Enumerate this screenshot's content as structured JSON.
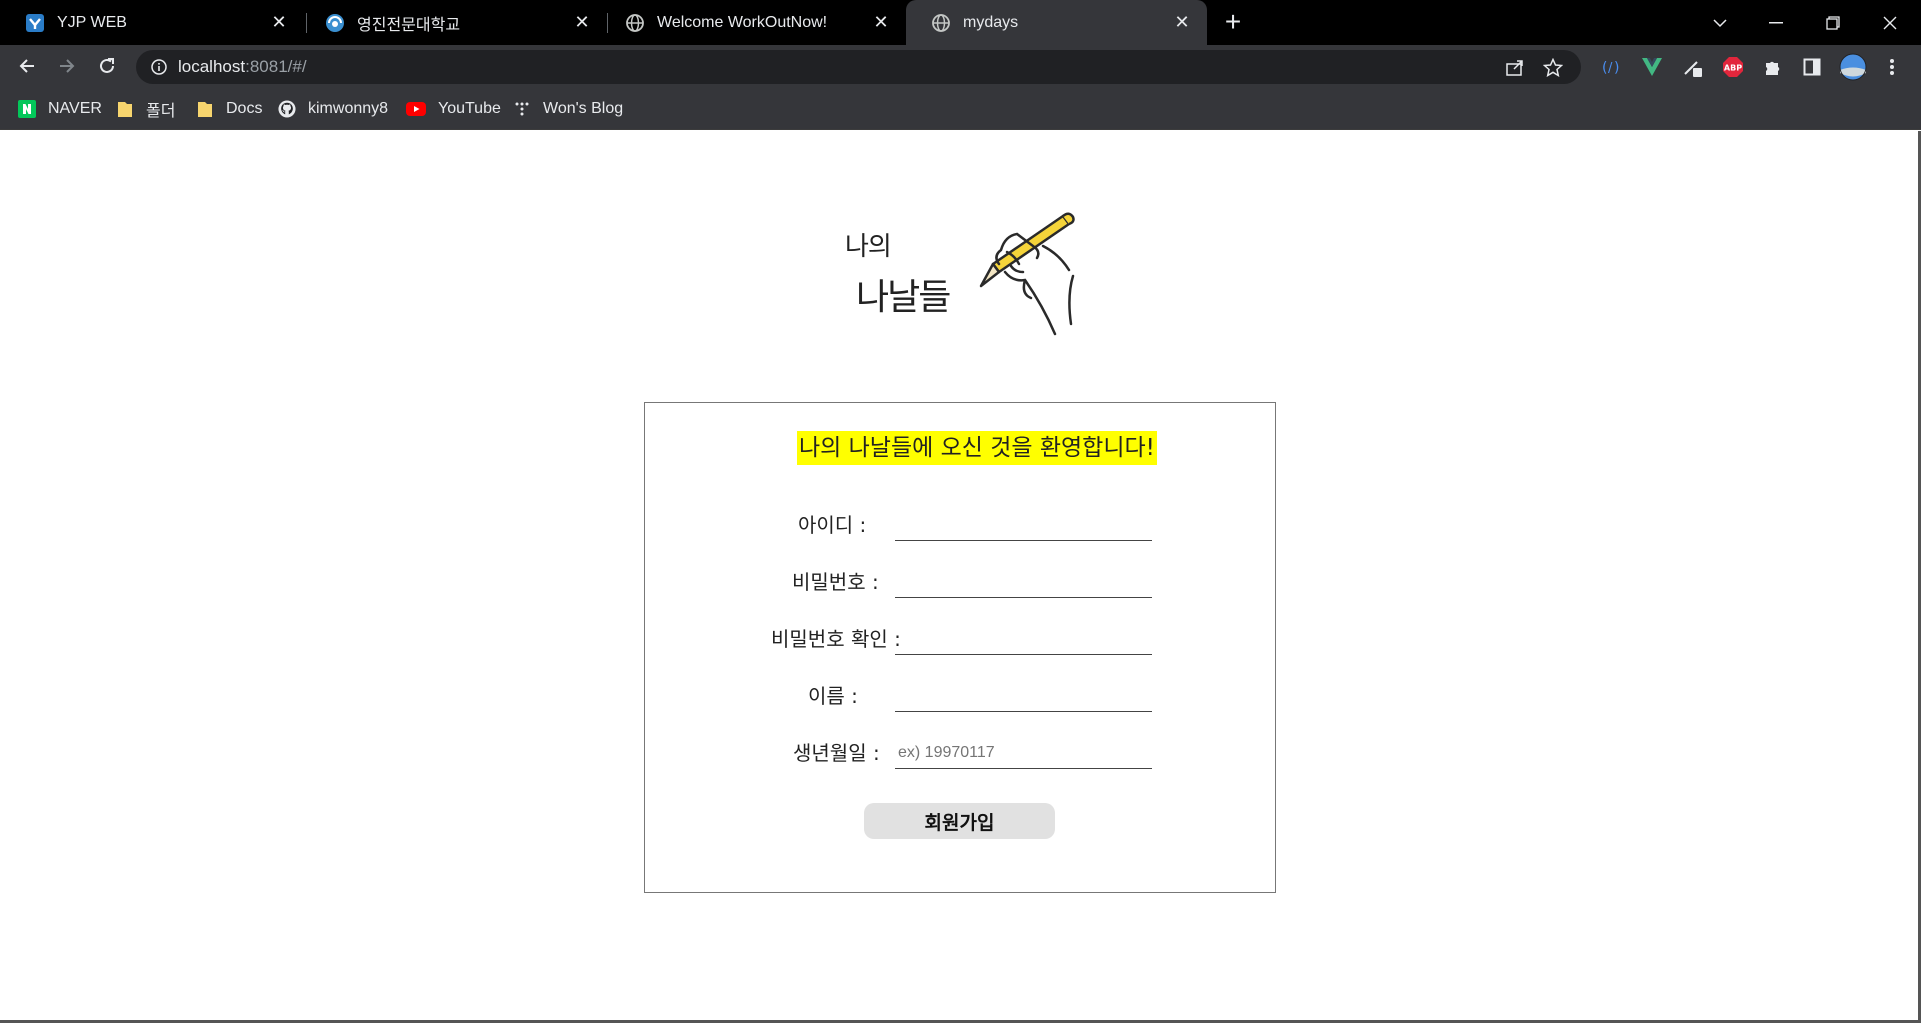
{
  "browser": {
    "tabs": [
      {
        "title": "YJP WEB",
        "active": false,
        "icon": "yjp-favicon"
      },
      {
        "title": "영진전문대학교",
        "active": false,
        "icon": "yeungjin-favicon"
      },
      {
        "title": "Welcome WorkOutNow!",
        "active": false,
        "icon": "globe-icon"
      },
      {
        "title": "mydays",
        "active": true,
        "icon": "globe-icon"
      }
    ],
    "address": {
      "host": "localhost",
      "rest": ":8081/#/"
    },
    "bookmarks": [
      {
        "label": "NAVER",
        "icon": "naver-icon"
      },
      {
        "label": "폴더",
        "icon": "folder-icon"
      },
      {
        "label": "Docs",
        "icon": "folder-icon"
      },
      {
        "label": "kimwonny8",
        "icon": "github-icon"
      },
      {
        "label": "YouTube",
        "icon": "youtube-icon"
      },
      {
        "label": "Won's Blog",
        "icon": "blog-icon"
      }
    ],
    "extensions": {
      "abp_label": "ABP"
    }
  },
  "logo": {
    "line1": "나의",
    "line2": "나날들"
  },
  "signup": {
    "welcome": "나의 나날들에 오신 것을 환영합니다!",
    "fields": [
      {
        "label": "아이디 :",
        "placeholder": ""
      },
      {
        "label": "비밀번호 :",
        "placeholder": ""
      },
      {
        "label": "비밀번호 확인 :",
        "placeholder": ""
      },
      {
        "label": "이름 :",
        "placeholder": ""
      },
      {
        "label": "생년월일 :",
        "placeholder": "ex) 19970117"
      }
    ],
    "submit_label": "회원가입"
  },
  "colors": {
    "highlight": "#ffff00",
    "tabbar": "#000000",
    "toolbar": "#35363a"
  }
}
